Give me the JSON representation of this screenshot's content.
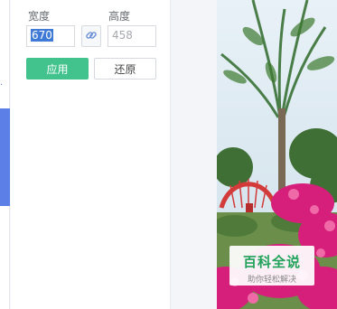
{
  "sidebar": {
    "glyph_top": "·",
    "glyph_bottom": "·"
  },
  "resize_panel": {
    "width_label": "宽度",
    "height_label": "高度",
    "width_value": "670",
    "height_placeholder": "458",
    "apply_label": "应用",
    "reset_label": "还原"
  },
  "preview": {
    "watermark_title": "百科全说",
    "watermark_subtitle": "助你轻松解决"
  },
  "colors": {
    "accent_blue": "#5b7fe6",
    "apply_green": "#42c28d",
    "selection": "#3f7ad6"
  }
}
